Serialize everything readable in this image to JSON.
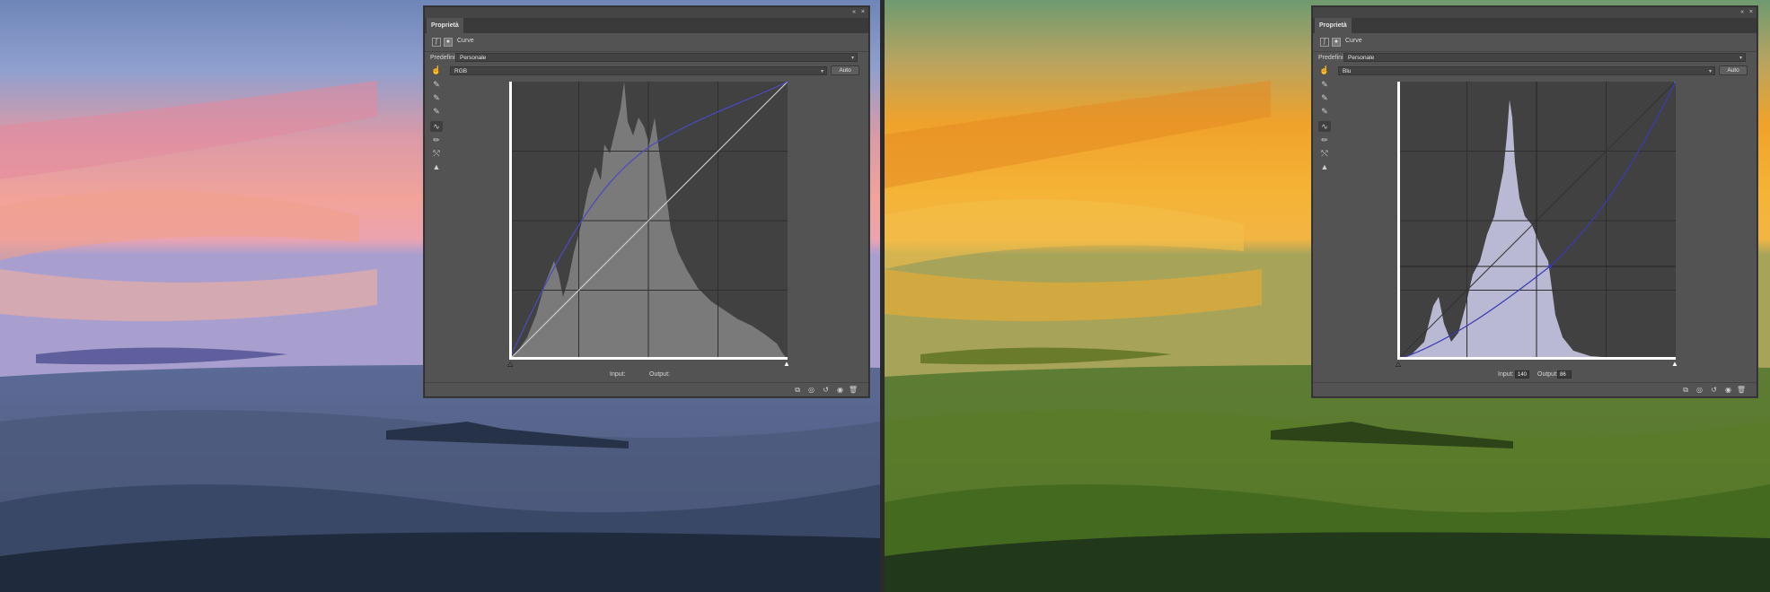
{
  "left_panel": {
    "tab_title": "Proprietà",
    "adjustment_title": "Curve",
    "preset_label": "Predefinito:",
    "preset_value": "Personale",
    "channel_value": "RGB",
    "auto_button": "Auto",
    "input_label": "Input:",
    "output_label": "Output:",
    "input_value": "",
    "output_value": ""
  },
  "right_panel": {
    "tab_title": "Proprietà",
    "adjustment_title": "Curve",
    "preset_label": "Predefinito:",
    "preset_value": "Personale",
    "channel_value": "Blu",
    "auto_button": "Auto",
    "input_label": "Input:",
    "output_label": "Output:",
    "input_value": "140",
    "output_value": "86"
  },
  "tools": [
    "sample-eyedropper-icon",
    "black-point-eyedropper-icon",
    "gray-point-eyedropper-icon",
    "white-point-eyedropper-icon",
    "curve-points-icon",
    "pencil-draw-icon",
    "smooth-curve-icon",
    "clipping-warning-icon"
  ],
  "footer_icons": [
    "clip-to-layer-icon",
    "view-previous-icon",
    "reset-icon",
    "visibility-icon",
    "delete-icon"
  ],
  "colors": {
    "panel_bg": "#535353",
    "graph_bg": "#414141",
    "rgb_curve": "#4a4ac4",
    "blue_curve": "#3a3ab8",
    "left_histogram": "#7a7a7a",
    "right_histogram": "#b9b9d3"
  }
}
